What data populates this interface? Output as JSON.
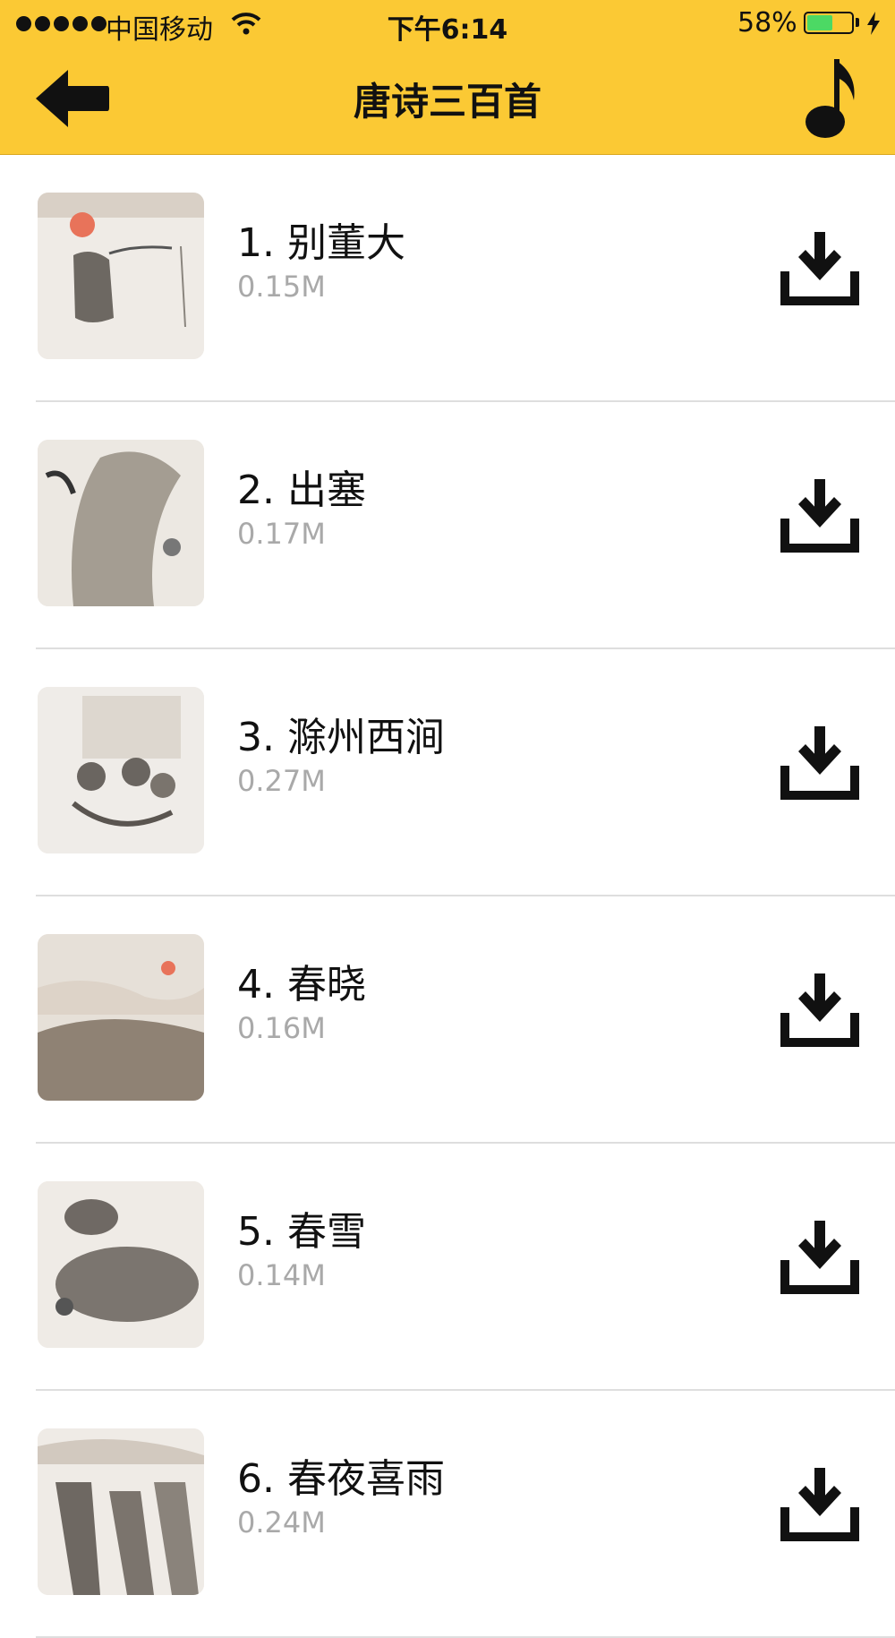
{
  "status_bar": {
    "carrier": "中国移动",
    "time": "下午6:14",
    "battery": "58%",
    "battery_level": 0.58
  },
  "nav": {
    "title": "唐诗三百首",
    "back_icon": "back-arrow-icon",
    "right_icon": "music-note-icon"
  },
  "colors": {
    "header_bg": "#fbc934",
    "size_text": "#a9a9a9",
    "divider": "#dedede"
  },
  "items": [
    {
      "title": "1. 别董大",
      "size": "0.15M"
    },
    {
      "title": "2. 出塞",
      "size": "0.17M"
    },
    {
      "title": "3. 滁州西涧",
      "size": "0.27M"
    },
    {
      "title": "4. 春晓",
      "size": "0.16M"
    },
    {
      "title": "5. 春雪",
      "size": "0.14M"
    },
    {
      "title": "6. 春夜喜雨",
      "size": "0.24M"
    }
  ]
}
